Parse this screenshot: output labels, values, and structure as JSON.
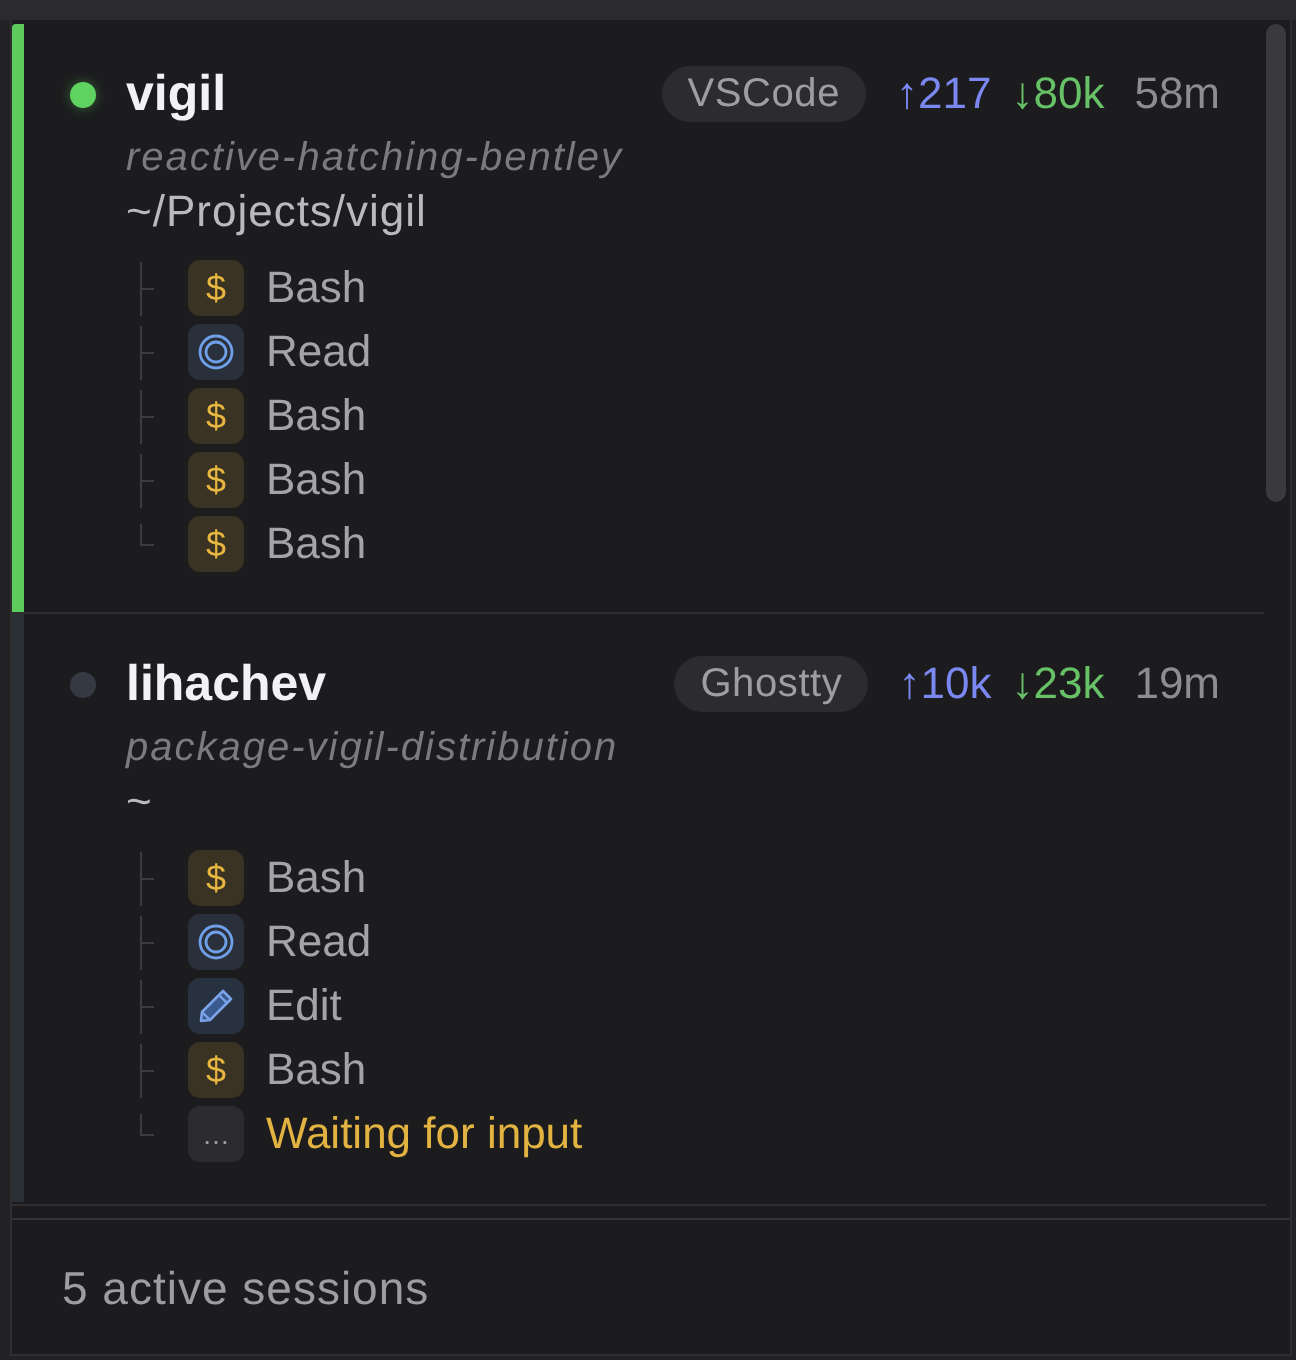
{
  "sessions": [
    {
      "name": "vigil",
      "active": true,
      "app": "VSCode",
      "up": "↑217",
      "down": "↓80k",
      "age": "58m",
      "slug": "reactive-hatching-bentley",
      "path": "~/Projects/vigil",
      "tools": [
        {
          "kind": "bash",
          "icon": "$",
          "label": "Bash"
        },
        {
          "kind": "read",
          "label": "Read"
        },
        {
          "kind": "bash",
          "icon": "$",
          "label": "Bash"
        },
        {
          "kind": "bash",
          "icon": "$",
          "label": "Bash"
        },
        {
          "kind": "bash",
          "icon": "$",
          "label": "Bash"
        }
      ]
    },
    {
      "name": "lihachev",
      "active": false,
      "app": "Ghostty",
      "up": "↑10k",
      "down": "↓23k",
      "age": "19m",
      "slug": "package-vigil-distribution",
      "path": "~",
      "tools": [
        {
          "kind": "bash",
          "icon": "$",
          "label": "Bash"
        },
        {
          "kind": "read",
          "label": "Read"
        },
        {
          "kind": "edit",
          "label": "Edit"
        },
        {
          "kind": "bash",
          "icon": "$",
          "label": "Bash"
        },
        {
          "kind": "waiting",
          "icon": "…",
          "label": "Waiting for input"
        }
      ]
    }
  ],
  "footer": {
    "status": "5 active sessions"
  }
}
